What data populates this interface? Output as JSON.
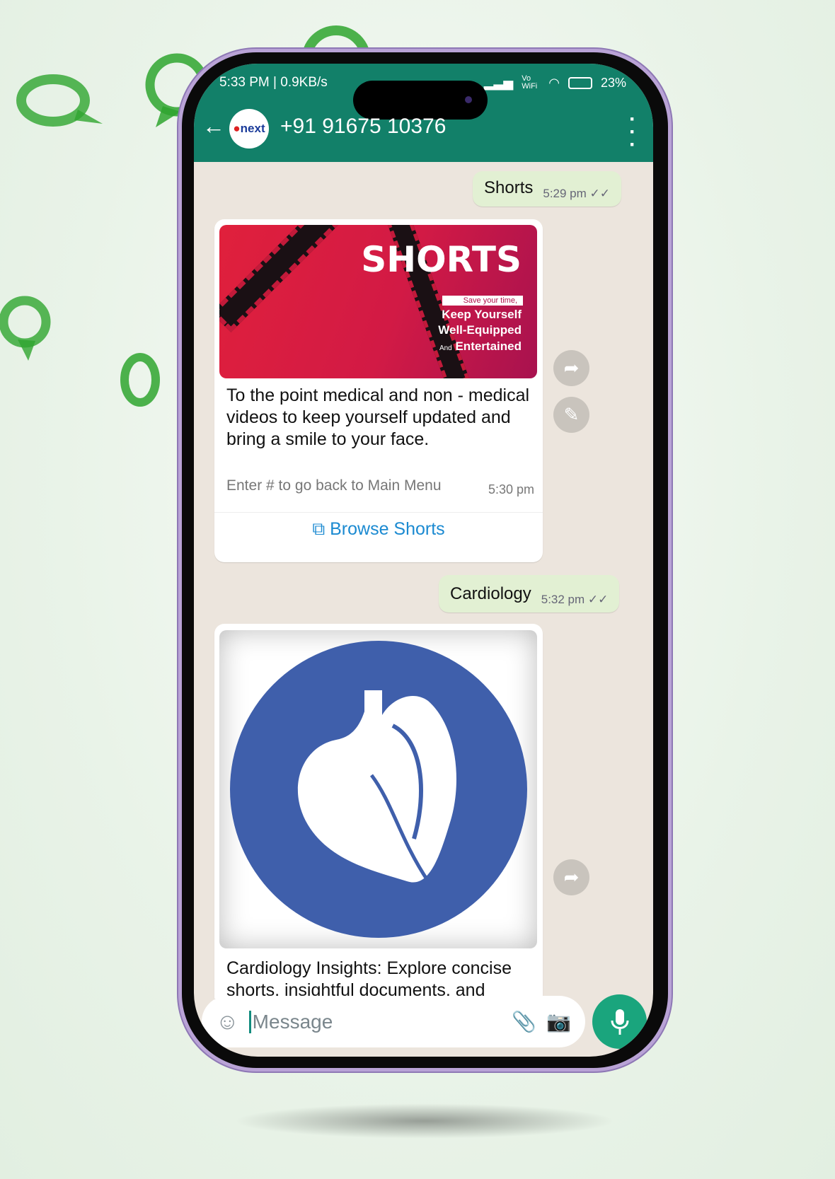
{
  "status_bar": {
    "time": "5:33 PM | 0.9KB/s",
    "signal": "Vo WiFi",
    "battery": "23%"
  },
  "header": {
    "contact": "+91 91675 10376",
    "avatar_text": "next",
    "back_icon": "arrow-left-icon",
    "menu_icon": "more-vertical-icon"
  },
  "messages": [
    {
      "type": "outgoing",
      "text": "Shorts",
      "time": "5:29 pm",
      "status": "read"
    },
    {
      "type": "incoming",
      "image": {
        "headline": "SHORTS",
        "tagline": "Save your time,",
        "line1": "Keep Yourself",
        "line2": "Well-Equipped",
        "line3_prefix": "And",
        "line3": "Entertained"
      },
      "body": "To the point medical and non - medical videos to keep yourself updated and bring a smile to your face.",
      "footer": "Enter # to go back to Main Menu",
      "time": "5:30 pm",
      "button": "Browse Shorts"
    },
    {
      "type": "outgoing",
      "text": "Cardiology",
      "time": "5:32 pm",
      "status": "read"
    },
    {
      "type": "incoming",
      "image": {
        "icon": "heart-icon"
      },
      "body": "Cardiology Insights: Explore concise shorts, insightful documents, and"
    }
  ],
  "input": {
    "placeholder": "Message"
  },
  "colors": {
    "header": "#128069",
    "outgoing": "#e2f0d3",
    "mic": "#1aa57d",
    "link": "#1b8ad1"
  }
}
